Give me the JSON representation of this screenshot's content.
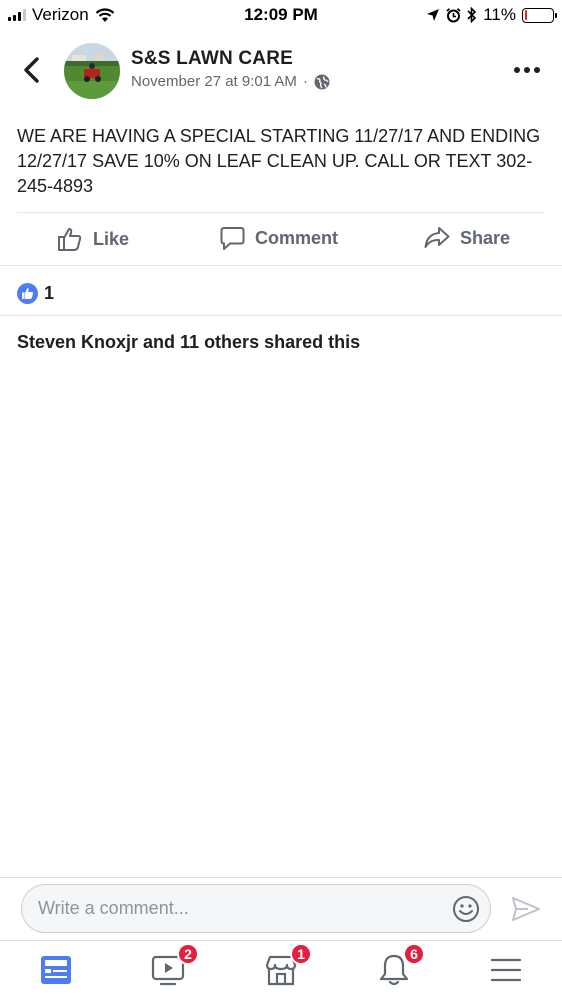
{
  "status_bar": {
    "carrier": "Verizon",
    "time": "12:09 PM",
    "battery_percent": "11%",
    "battery_level": 0.11
  },
  "post": {
    "page_name": "S&S LAWN CARE",
    "timestamp": "November 27 at 9:01 AM",
    "separator": "·",
    "text": "WE ARE HAVING A SPECIAL STARTING 11/27/17 AND ENDING 12/27/17 SAVE 10% ON LEAF CLEAN UP. CALL OR TEXT 302-245-4893",
    "reaction_count": "1",
    "shares_text": "Steven Knoxjr and 11 others shared this"
  },
  "actions": {
    "like_label": "Like",
    "comment_label": "Comment",
    "share_label": "Share"
  },
  "composer": {
    "placeholder": "Write a comment..."
  },
  "tabbar": {
    "items": [
      {
        "icon": "news-feed-icon",
        "badge": ""
      },
      {
        "icon": "watch-icon",
        "badge": "2"
      },
      {
        "icon": "marketplace-icon",
        "badge": "1"
      },
      {
        "icon": "notifications-icon",
        "badge": "6"
      },
      {
        "icon": "menu-icon",
        "badge": ""
      }
    ]
  },
  "colors": {
    "accent": "#4d7cf4",
    "badge": "#e41e3f",
    "secondary_text": "#606770"
  }
}
